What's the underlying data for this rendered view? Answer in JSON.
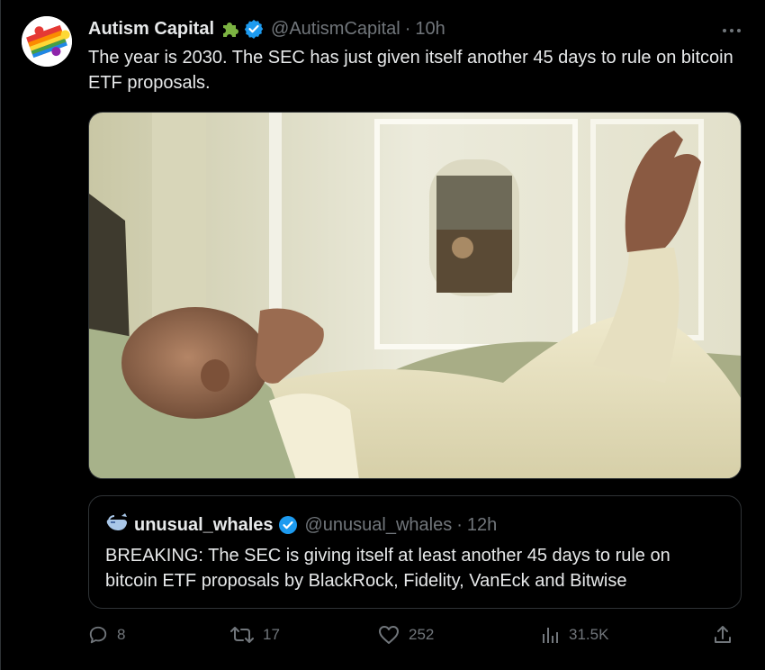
{
  "tweet": {
    "display_name": "Autism Capital",
    "handle": "@AutismCapital",
    "separator": "·",
    "time": "10h",
    "text": "The year is 2030. The SEC has just given itself another 45 days to rule on bitcoin ETF proposals."
  },
  "quoted": {
    "display_name": "unusual_whales",
    "handle": "@unusual_whales",
    "separator": "·",
    "time": "12h",
    "text": "BREAKING: The SEC is giving itself at least another 45 days to rule on bitcoin ETF proposals by BlackRock, Fidelity, VanEck and Bitwise"
  },
  "actions": {
    "replies": "8",
    "retweets": "17",
    "likes": "252",
    "views": "31.5K"
  },
  "icons": {
    "more": "more-horizontal-icon",
    "verified": "verified-badge-icon",
    "puzzle": "puzzle-piece-emoji",
    "reply": "reply-icon",
    "retweet": "retweet-icon",
    "like": "heart-icon",
    "views": "views-chart-icon",
    "share": "share-icon"
  },
  "colors": {
    "background": "#000000",
    "text": "#e7e9ea",
    "muted": "#71767b",
    "verified": "#1d9bf0",
    "border": "#2f3336"
  }
}
